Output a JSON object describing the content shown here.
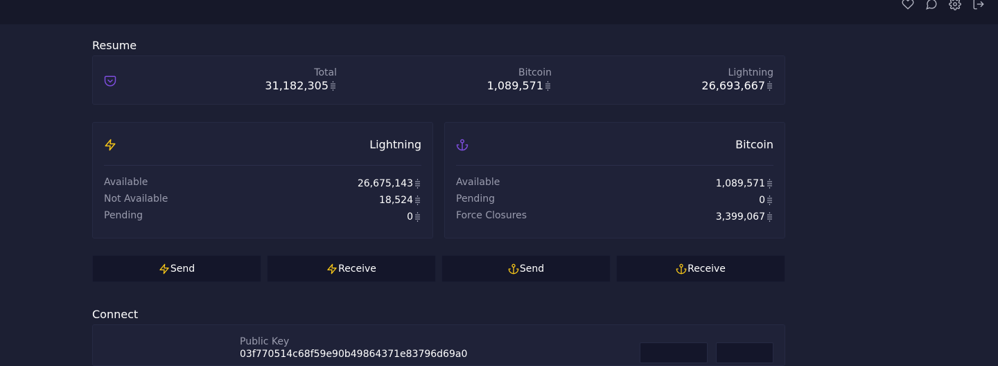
{
  "colors": {
    "background": "#1c1f33",
    "topbar": "#161829",
    "card": "#1f2238",
    "button": "#14162a",
    "lightning_accent": "#f5c518",
    "bitcoin_accent": "#7c4ddb",
    "muted_text": "#9a9cae"
  },
  "topbar": {
    "icons": [
      "heart-icon",
      "chat-icon",
      "gear-icon",
      "logout-icon"
    ]
  },
  "resume": {
    "title": "Resume",
    "icon": "pocket-icon",
    "total": {
      "label": "Total",
      "value": "31,182,305"
    },
    "bitcoin": {
      "label": "Bitcoin",
      "value": "1,089,571"
    },
    "lightning": {
      "label": "Lightning",
      "value": "26,693,667"
    }
  },
  "lightning_wallet": {
    "title": "Lightning",
    "icon": "zap-icon",
    "rows": [
      {
        "label": "Available",
        "value": "26,675,143"
      },
      {
        "label": "Not Available",
        "value": "18,524"
      },
      {
        "label": "Pending",
        "value": "0"
      }
    ]
  },
  "bitcoin_wallet": {
    "title": "Bitcoin",
    "icon": "anchor-icon",
    "rows": [
      {
        "label": "Available",
        "value": "1,089,571"
      },
      {
        "label": "Pending",
        "value": "0"
      },
      {
        "label": "Force Closures",
        "value": "3,399,067"
      }
    ]
  },
  "actions": {
    "lightning_send": "Send",
    "lightning_receive": "Receive",
    "bitcoin_send": "Send",
    "bitcoin_receive": "Receive"
  },
  "connect": {
    "title": "Connect",
    "public_key_label": "Public Key",
    "public_key_value": "03f770514c68f59e90b49864371e83796d69a0"
  }
}
